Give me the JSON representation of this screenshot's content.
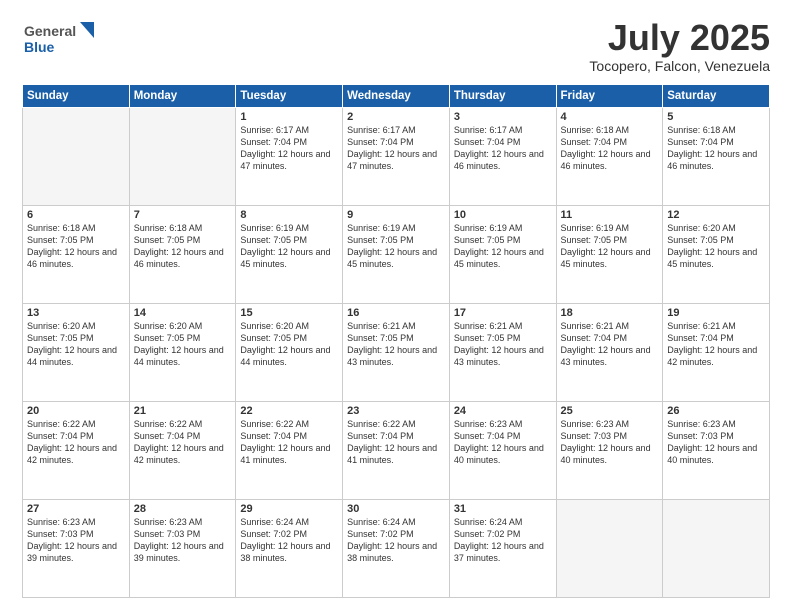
{
  "header": {
    "logo_line1": "General",
    "logo_line2": "Blue",
    "month": "July 2025",
    "location": "Tocopero, Falcon, Venezuela"
  },
  "days_of_week": [
    "Sunday",
    "Monday",
    "Tuesday",
    "Wednesday",
    "Thursday",
    "Friday",
    "Saturday"
  ],
  "weeks": [
    [
      {
        "day": "",
        "info": ""
      },
      {
        "day": "",
        "info": ""
      },
      {
        "day": "1",
        "info": "Sunrise: 6:17 AM\nSunset: 7:04 PM\nDaylight: 12 hours and 47 minutes."
      },
      {
        "day": "2",
        "info": "Sunrise: 6:17 AM\nSunset: 7:04 PM\nDaylight: 12 hours and 47 minutes."
      },
      {
        "day": "3",
        "info": "Sunrise: 6:17 AM\nSunset: 7:04 PM\nDaylight: 12 hours and 46 minutes."
      },
      {
        "day": "4",
        "info": "Sunrise: 6:18 AM\nSunset: 7:04 PM\nDaylight: 12 hours and 46 minutes."
      },
      {
        "day": "5",
        "info": "Sunrise: 6:18 AM\nSunset: 7:04 PM\nDaylight: 12 hours and 46 minutes."
      }
    ],
    [
      {
        "day": "6",
        "info": "Sunrise: 6:18 AM\nSunset: 7:05 PM\nDaylight: 12 hours and 46 minutes."
      },
      {
        "day": "7",
        "info": "Sunrise: 6:18 AM\nSunset: 7:05 PM\nDaylight: 12 hours and 46 minutes."
      },
      {
        "day": "8",
        "info": "Sunrise: 6:19 AM\nSunset: 7:05 PM\nDaylight: 12 hours and 45 minutes."
      },
      {
        "day": "9",
        "info": "Sunrise: 6:19 AM\nSunset: 7:05 PM\nDaylight: 12 hours and 45 minutes."
      },
      {
        "day": "10",
        "info": "Sunrise: 6:19 AM\nSunset: 7:05 PM\nDaylight: 12 hours and 45 minutes."
      },
      {
        "day": "11",
        "info": "Sunrise: 6:19 AM\nSunset: 7:05 PM\nDaylight: 12 hours and 45 minutes."
      },
      {
        "day": "12",
        "info": "Sunrise: 6:20 AM\nSunset: 7:05 PM\nDaylight: 12 hours and 45 minutes."
      }
    ],
    [
      {
        "day": "13",
        "info": "Sunrise: 6:20 AM\nSunset: 7:05 PM\nDaylight: 12 hours and 44 minutes."
      },
      {
        "day": "14",
        "info": "Sunrise: 6:20 AM\nSunset: 7:05 PM\nDaylight: 12 hours and 44 minutes."
      },
      {
        "day": "15",
        "info": "Sunrise: 6:20 AM\nSunset: 7:05 PM\nDaylight: 12 hours and 44 minutes."
      },
      {
        "day": "16",
        "info": "Sunrise: 6:21 AM\nSunset: 7:05 PM\nDaylight: 12 hours and 43 minutes."
      },
      {
        "day": "17",
        "info": "Sunrise: 6:21 AM\nSunset: 7:05 PM\nDaylight: 12 hours and 43 minutes."
      },
      {
        "day": "18",
        "info": "Sunrise: 6:21 AM\nSunset: 7:04 PM\nDaylight: 12 hours and 43 minutes."
      },
      {
        "day": "19",
        "info": "Sunrise: 6:21 AM\nSunset: 7:04 PM\nDaylight: 12 hours and 42 minutes."
      }
    ],
    [
      {
        "day": "20",
        "info": "Sunrise: 6:22 AM\nSunset: 7:04 PM\nDaylight: 12 hours and 42 minutes."
      },
      {
        "day": "21",
        "info": "Sunrise: 6:22 AM\nSunset: 7:04 PM\nDaylight: 12 hours and 42 minutes."
      },
      {
        "day": "22",
        "info": "Sunrise: 6:22 AM\nSunset: 7:04 PM\nDaylight: 12 hours and 41 minutes."
      },
      {
        "day": "23",
        "info": "Sunrise: 6:22 AM\nSunset: 7:04 PM\nDaylight: 12 hours and 41 minutes."
      },
      {
        "day": "24",
        "info": "Sunrise: 6:23 AM\nSunset: 7:04 PM\nDaylight: 12 hours and 40 minutes."
      },
      {
        "day": "25",
        "info": "Sunrise: 6:23 AM\nSunset: 7:03 PM\nDaylight: 12 hours and 40 minutes."
      },
      {
        "day": "26",
        "info": "Sunrise: 6:23 AM\nSunset: 7:03 PM\nDaylight: 12 hours and 40 minutes."
      }
    ],
    [
      {
        "day": "27",
        "info": "Sunrise: 6:23 AM\nSunset: 7:03 PM\nDaylight: 12 hours and 39 minutes."
      },
      {
        "day": "28",
        "info": "Sunrise: 6:23 AM\nSunset: 7:03 PM\nDaylight: 12 hours and 39 minutes."
      },
      {
        "day": "29",
        "info": "Sunrise: 6:24 AM\nSunset: 7:02 PM\nDaylight: 12 hours and 38 minutes."
      },
      {
        "day": "30",
        "info": "Sunrise: 6:24 AM\nSunset: 7:02 PM\nDaylight: 12 hours and 38 minutes."
      },
      {
        "day": "31",
        "info": "Sunrise: 6:24 AM\nSunset: 7:02 PM\nDaylight: 12 hours and 37 minutes."
      },
      {
        "day": "",
        "info": ""
      },
      {
        "day": "",
        "info": ""
      }
    ]
  ]
}
